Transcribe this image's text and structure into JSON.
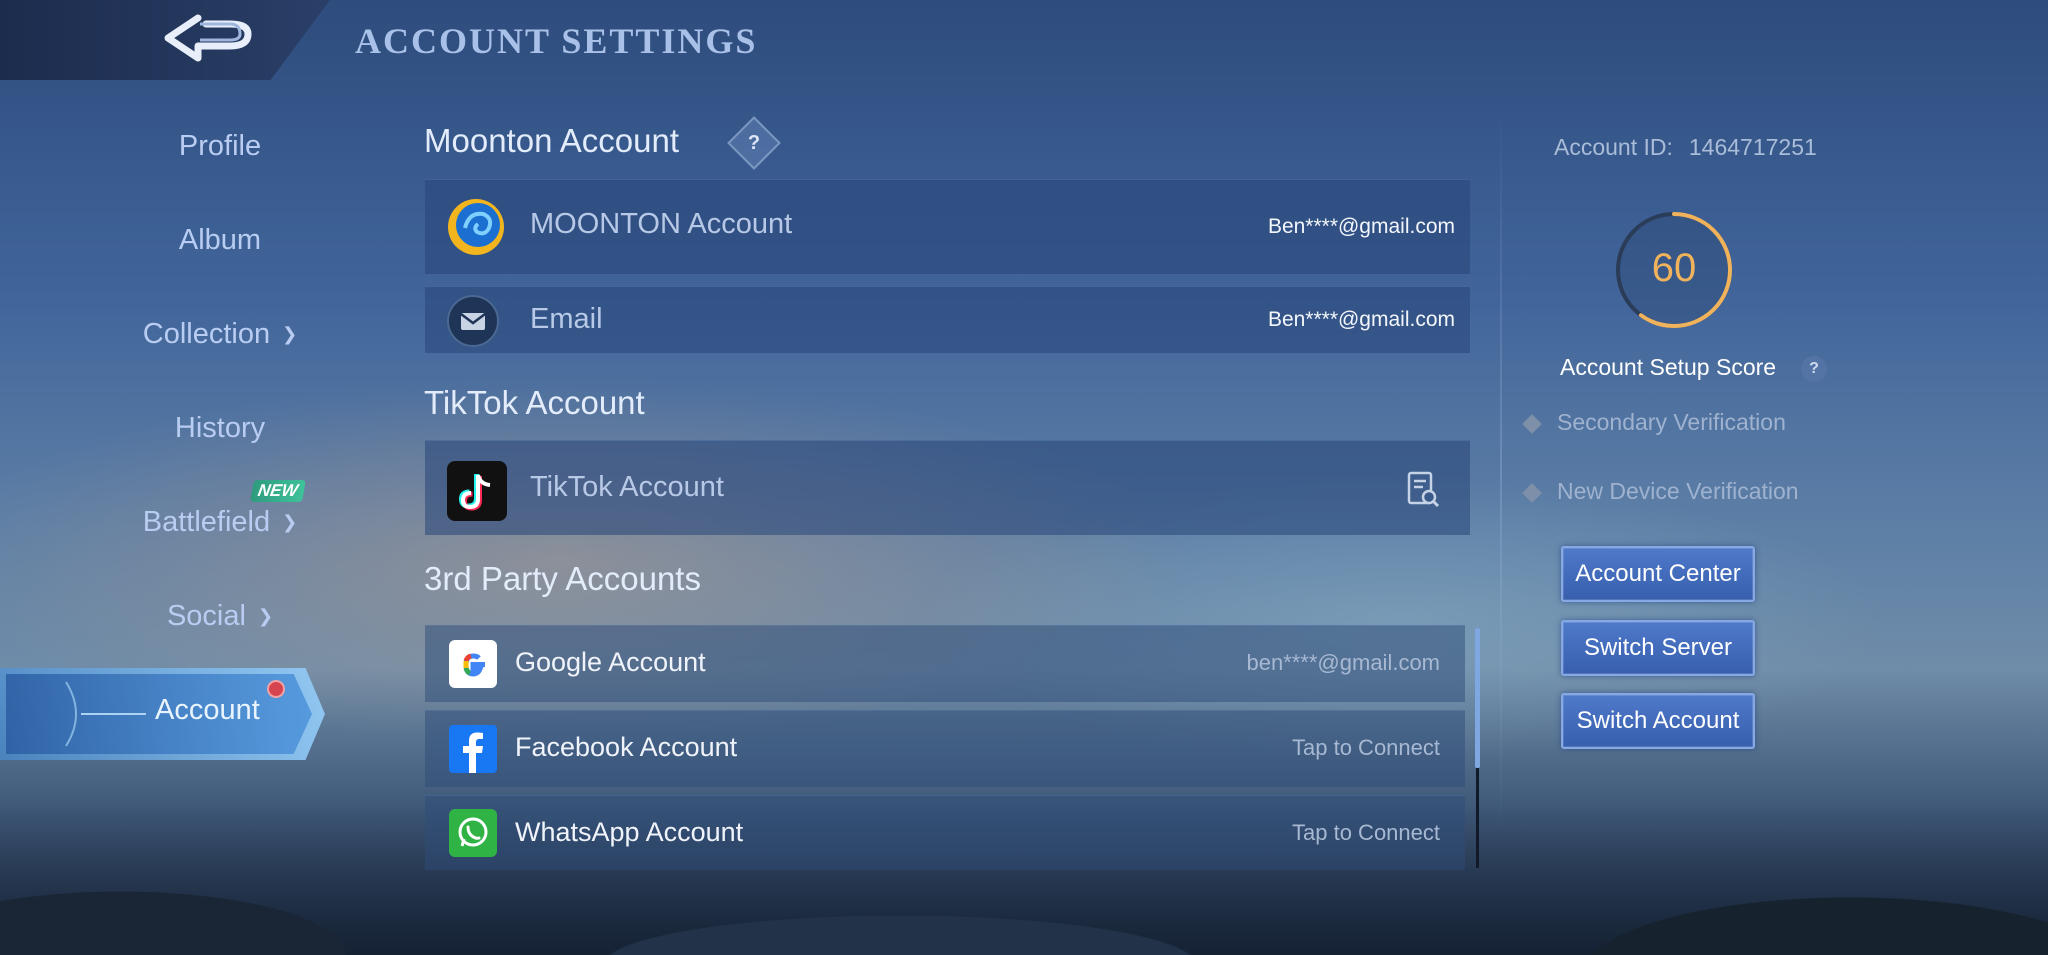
{
  "header": {
    "title": "ACCOUNT SETTINGS"
  },
  "sidebar": {
    "items": [
      {
        "label": "Profile"
      },
      {
        "label": "Album"
      },
      {
        "label": "Collection"
      },
      {
        "label": "History"
      },
      {
        "label": "Battlefield",
        "badge": "NEW"
      },
      {
        "label": "Social"
      },
      {
        "label": "Account"
      }
    ]
  },
  "moonton": {
    "title": "Moonton Account",
    "help": "?",
    "rows": [
      {
        "label": "MOONTON Account",
        "value": "Ben****@gmail.com"
      },
      {
        "label": "Email",
        "value": "Ben****@gmail.com"
      }
    ]
  },
  "tiktok": {
    "title": "TikTok Account",
    "row": {
      "label": "TikTok Account"
    }
  },
  "third_party": {
    "title": "3rd Party Accounts",
    "rows": [
      {
        "label": "Google Account",
        "value": "ben****@gmail.com"
      },
      {
        "label": "Facebook Account",
        "value": "Tap to Connect"
      },
      {
        "label": "WhatsApp Account",
        "value": "Tap to Connect"
      }
    ]
  },
  "right_panel": {
    "account_id_label": "Account ID:",
    "account_id": "1464717251",
    "score": "60",
    "score_label": "Account Setup Score",
    "help": "?",
    "verifications": [
      "Secondary Verification",
      "New Device Verification"
    ],
    "buttons": [
      "Account Center",
      "Switch Server",
      "Switch Account"
    ]
  },
  "colors": {
    "score_ring": "#f0b35c",
    "accent": "#86a9e5"
  }
}
